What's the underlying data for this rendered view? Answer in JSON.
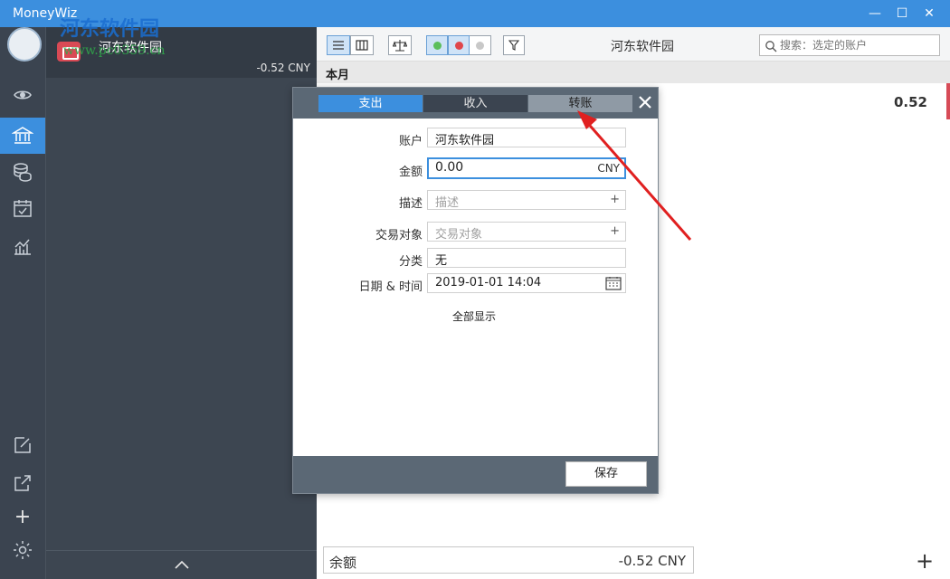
{
  "window": {
    "title": "MoneyWiz",
    "minimize": "—",
    "maximize": "☐",
    "close": "✕"
  },
  "watermark": {
    "text": "河东软件园",
    "url": "www.pc0359.cn"
  },
  "rail": {
    "items": [
      "eye-icon",
      "bank-icon",
      "coins-icon",
      "calendar-check-icon",
      "chart-icon"
    ],
    "active": "bank-icon",
    "bottom_items": [
      "edit-icon",
      "export-icon",
      "plus-icon",
      "gear-icon"
    ],
    "plus_label": "+"
  },
  "accounts": {
    "items": [
      {
        "name": "河东软件园",
        "balance": "-0.52 CNY",
        "color": "#d94a55"
      }
    ]
  },
  "toolbar": {
    "title": "河东软件园",
    "search_placeholder": "搜索：选定的账户",
    "status_dots": [
      "#5cbf5c",
      "#e0474c",
      "#c8c8c8"
    ]
  },
  "list": {
    "period_header": "本月",
    "row_amount": "0.52"
  },
  "footer": {
    "balance_label": "余额",
    "balance_value": "-0.52 CNY",
    "add_label": "+"
  },
  "dialog": {
    "tabs": [
      "支出",
      "收入",
      "转账"
    ],
    "active_tab": "支出",
    "close_label": "✕",
    "fields": {
      "account": {
        "label": "账户",
        "value": "河东软件园"
      },
      "amount": {
        "label": "金额",
        "value": "0.00",
        "unit": "CNY"
      },
      "description": {
        "label": "描述",
        "placeholder": "描述",
        "add": "+"
      },
      "payee": {
        "label": "交易对象",
        "placeholder": "交易对象",
        "add": "+"
      },
      "category": {
        "label": "分类",
        "value": "无"
      },
      "datetime": {
        "label": "日期 & 时间",
        "value": "2019-01-01 14:04"
      }
    },
    "show_all": "全部显示",
    "save_label": "保存"
  },
  "colors": {
    "accent": "#3c8fde",
    "sidebar": "#3b4450",
    "annotation_arrow": "#e02020"
  }
}
